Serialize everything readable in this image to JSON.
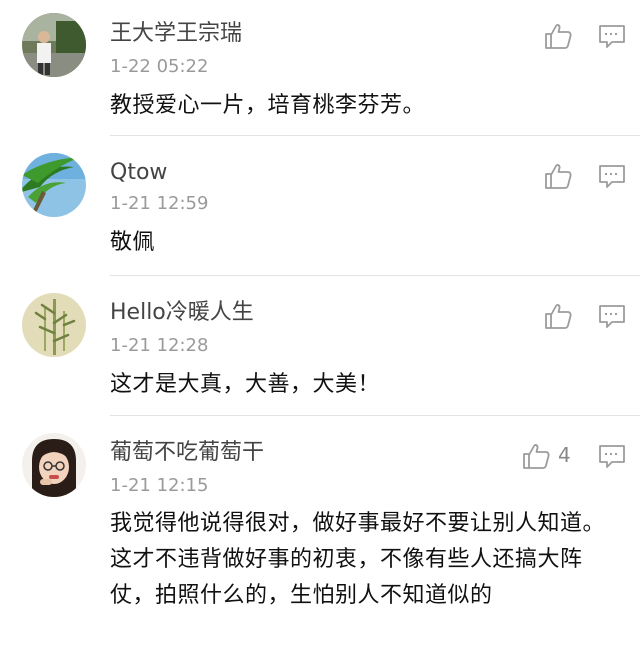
{
  "comments": [
    {
      "user": "王大学王宗瑞",
      "time": "1-22 05:22",
      "text": "教授爱心一片，培育桃李芬芳。",
      "likes": null
    },
    {
      "user": "Qtow",
      "time": "1-21 12:59",
      "text": "敬佩",
      "likes": null
    },
    {
      "user": "Hello冷暖人生",
      "time": "1-21 12:28",
      "text": "这才是大真，大善，大美！",
      "likes": null
    },
    {
      "user": "葡萄不吃葡萄干",
      "time": "1-21 12:15",
      "text": "我觉得他说得很对，做好事最好不要让别人知道。这才不违背做好事的初衷，不像有些人还搞大阵仗，拍照什么的，生怕别人不知道似的",
      "likes": "4"
    }
  ],
  "icons": {
    "like": "thumbs-up-outline-icon",
    "reply": "comment-bubble-icon"
  },
  "colors": {
    "icon": "#9c9c9c",
    "name": "#444444",
    "time": "#9a9a9a",
    "text": "#111111",
    "divider": "#e3e3e3"
  }
}
